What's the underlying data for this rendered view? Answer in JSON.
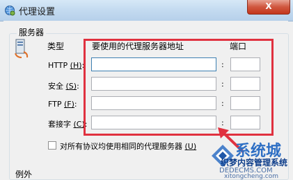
{
  "window": {
    "title": "代理设置",
    "close_label": "X"
  },
  "servers": {
    "group_label": "服务器",
    "col_type": "类型",
    "col_address": "要使用的代理服务器地址",
    "col_port": "端口",
    "rows": [
      {
        "label": "HTTP",
        "accel": "(H)",
        "address": "",
        "port": ""
      },
      {
        "label": "安全",
        "accel": "(S)",
        "address": "",
        "port": ""
      },
      {
        "label": "FTP",
        "accel": "(F)",
        "address": "",
        "port": ""
      },
      {
        "label": "套接字",
        "accel": "(C)",
        "address": "",
        "port": ""
      }
    ],
    "colon": ":",
    "same_proxy_label": "对所有协议均使用相同的代理服务器",
    "same_proxy_accel": "(U)",
    "same_proxy_checked": false
  },
  "exceptions": {
    "group_label": "例外"
  },
  "watermark": {
    "line1": "系统城",
    "line2": "织梦内容管理系统",
    "line3": "DEDECMS.COM",
    "line4": "xitongcheng.com"
  },
  "colors": {
    "highlight": "#e0313f",
    "title_bg": "#c3daf0",
    "close_bg": "#c3361c"
  }
}
